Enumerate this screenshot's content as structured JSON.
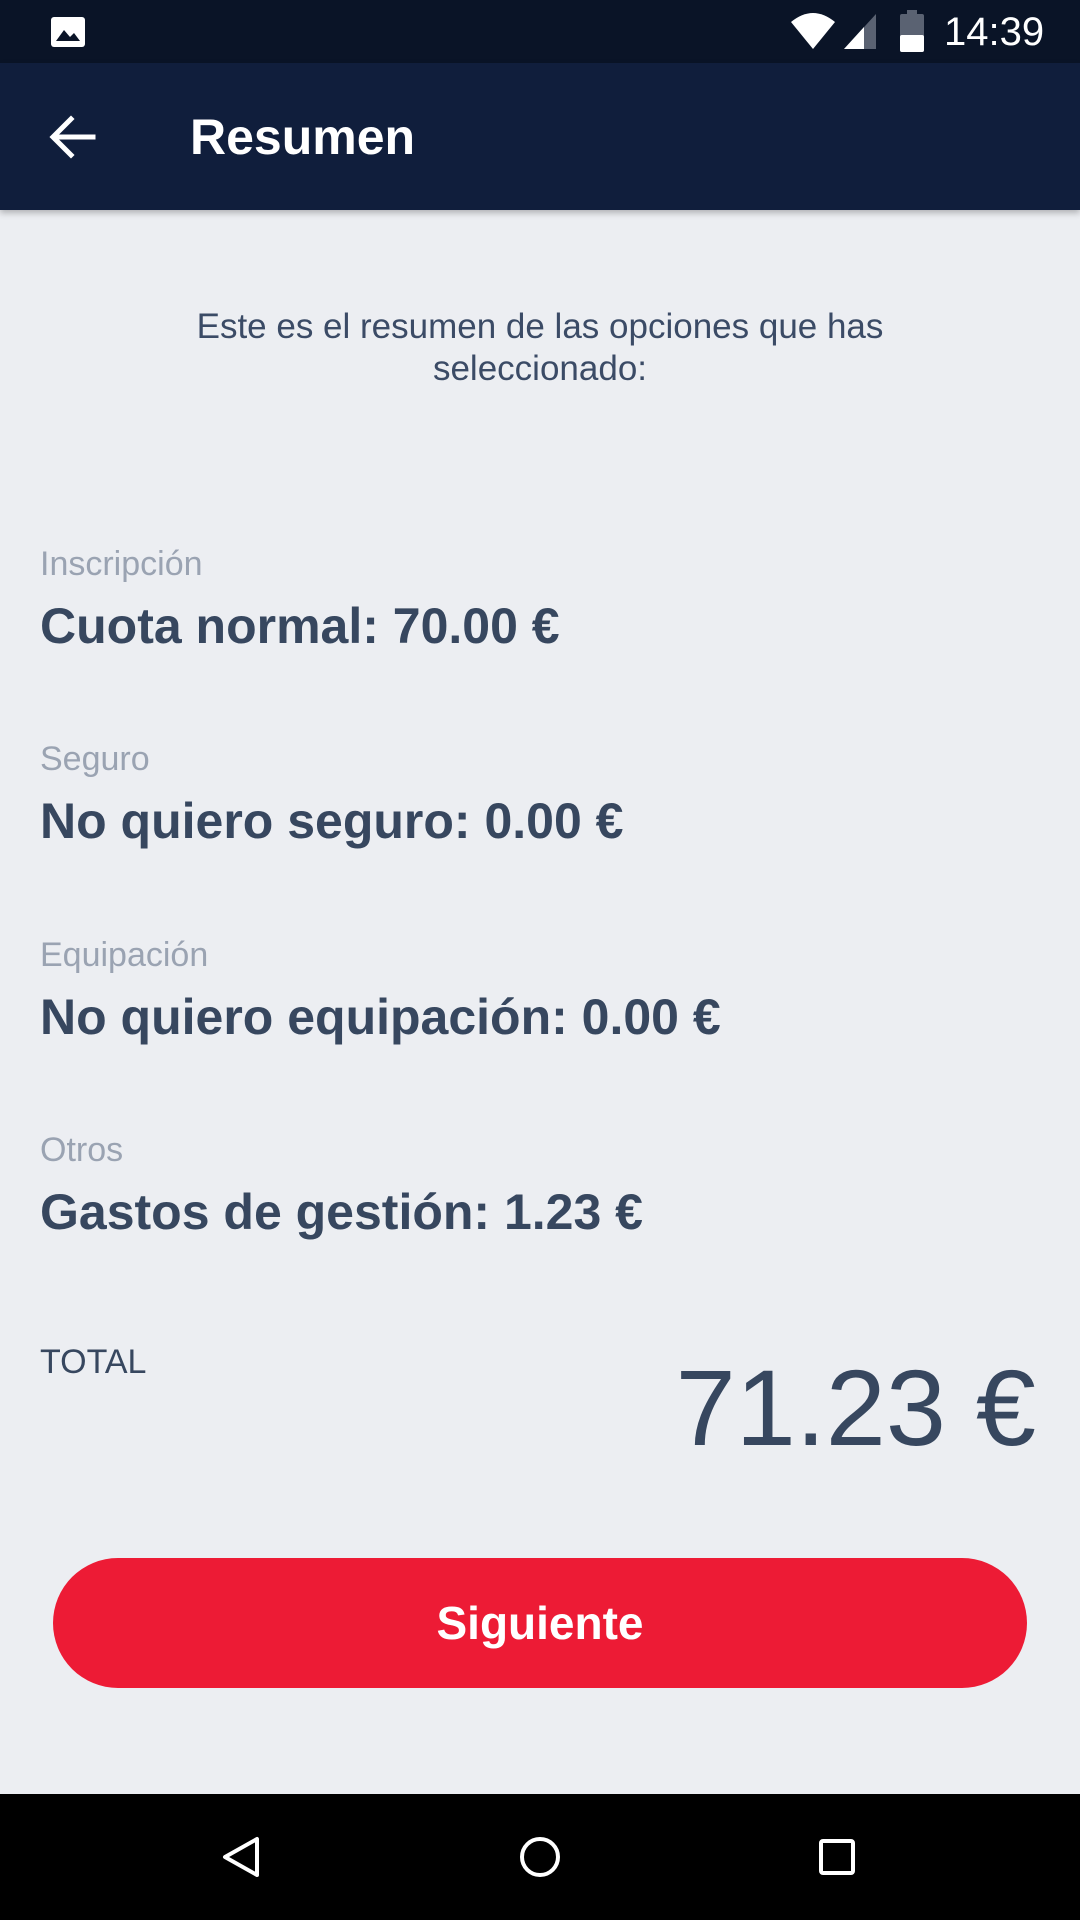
{
  "status_bar": {
    "time": "14:39",
    "icons": [
      "gallery-icon",
      "wifi-icon",
      "signal-icon",
      "battery-icon"
    ]
  },
  "header": {
    "title": "Resumen",
    "back_icon": "arrow-left-icon",
    "background": "#101e3c"
  },
  "intro": {
    "text": "Este es el resumen de las opciones que has seleccionado:"
  },
  "summary": [
    {
      "label": "Inscripción",
      "value": "Cuota normal: 70.00 €"
    },
    {
      "label": "Seguro",
      "value": "No quiero seguro: 0.00 €"
    },
    {
      "label": "Equipación",
      "value": "No quiero equipación: 0.00 €"
    },
    {
      "label": "Otros",
      "value": "Gastos de gestión: 1.23 €"
    }
  ],
  "total": {
    "label": "TOTAL",
    "amount": "71.23 €"
  },
  "actions": {
    "next_label": "Siguiente",
    "next_color": "#ed1b35"
  },
  "nav_bar": {
    "icons": [
      "back-triangle-icon",
      "home-circle-icon",
      "recents-square-icon"
    ]
  }
}
